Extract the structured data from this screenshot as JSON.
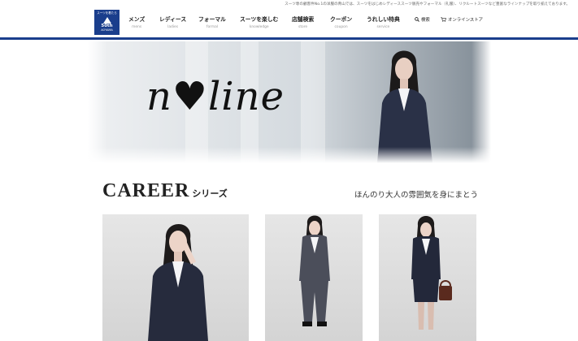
{
  "top_note": "スーツ専の顧客件No.1の洋服の青山では、スーツをはじめレディーススーツ販売やフォーマル（礼服）、リクルートスーツなど豊富なラインナップを取り揃えております。",
  "logo": {
    "line1": "スーツを着たら",
    "line2": "50th",
    "line3": "AOYAMA",
    "brand_color": "#1a3e8c"
  },
  "nav": [
    {
      "label": "メンズ",
      "sub": "mens"
    },
    {
      "label": "レディース",
      "sub": "ladies"
    },
    {
      "label": "フォーマル",
      "sub": "formal"
    },
    {
      "label": "スーツを楽しむ",
      "sub": "knowledge"
    },
    {
      "label": "店舗検索",
      "sub": "store"
    },
    {
      "label": "クーポン",
      "sub": "coupon"
    },
    {
      "label": "うれしい特典",
      "sub": "service"
    }
  ],
  "utility": {
    "search_label": "検索",
    "store_label": "オンラインストア",
    "search_icon": "search-icon",
    "store_icon": "cart-icon"
  },
  "hero": {
    "logo_text": "n♥line"
  },
  "career": {
    "title": "CAREER",
    "subtitle": "シリーズ",
    "tagline": "ほんのり大人の雰囲気を身にまとう"
  }
}
